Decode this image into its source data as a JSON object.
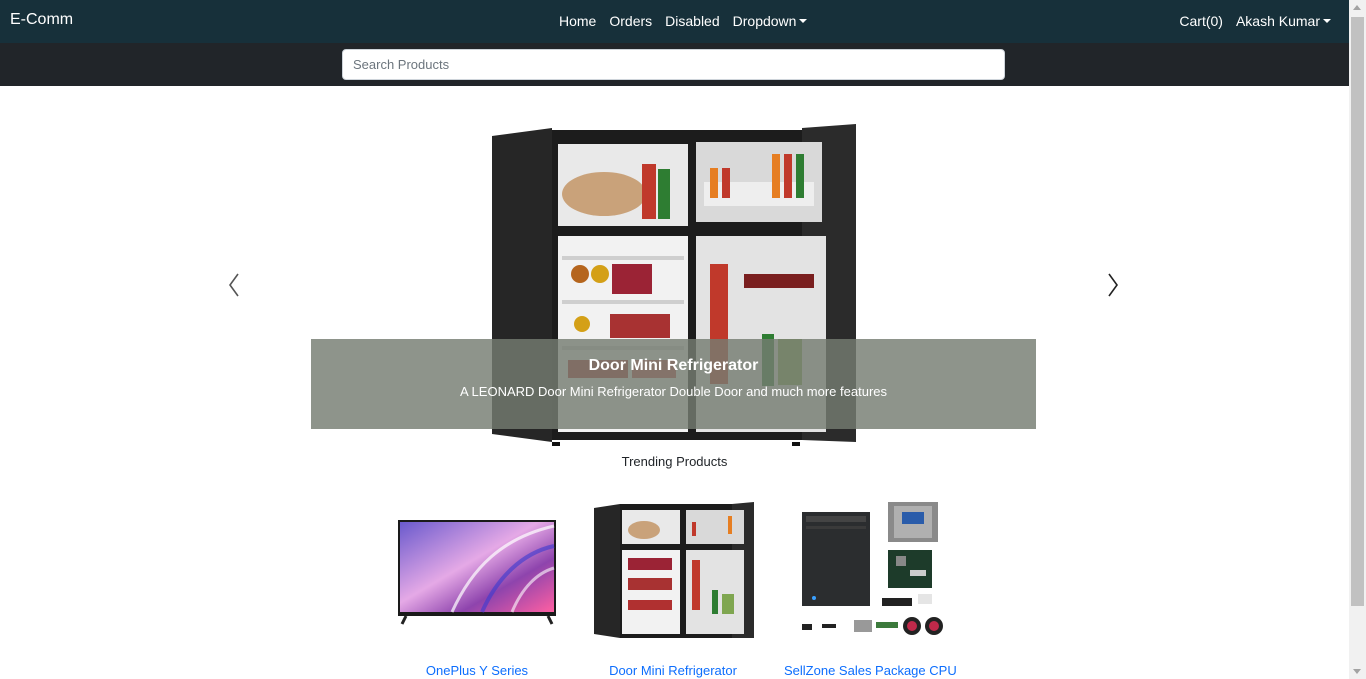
{
  "navbar": {
    "brand": "E-Comm",
    "links": [
      "Home",
      "Orders",
      "Disabled",
      "Dropdown"
    ],
    "cart": "Cart(0)",
    "user": "Akash Kumar"
  },
  "search": {
    "placeholder": "Search Products"
  },
  "carousel": {
    "caption_title": "Door Mini Refrigerator",
    "caption_text": "A LEONARD Door Mini Refrigerator Double Door and much more features"
  },
  "trending_label": "Trending Products",
  "products": [
    {
      "name": "OnePlus Y Series",
      "icon": "tv-icon"
    },
    {
      "name": "Door Mini Refrigerator",
      "icon": "fridge-icon"
    },
    {
      "name": "SellZone Sales Package CPU",
      "icon": "cpu-icon"
    }
  ],
  "colors": {
    "navbar": "#17303a",
    "search_band": "#212529",
    "link": "#0d6efd",
    "caption_bg": "#757c71"
  }
}
